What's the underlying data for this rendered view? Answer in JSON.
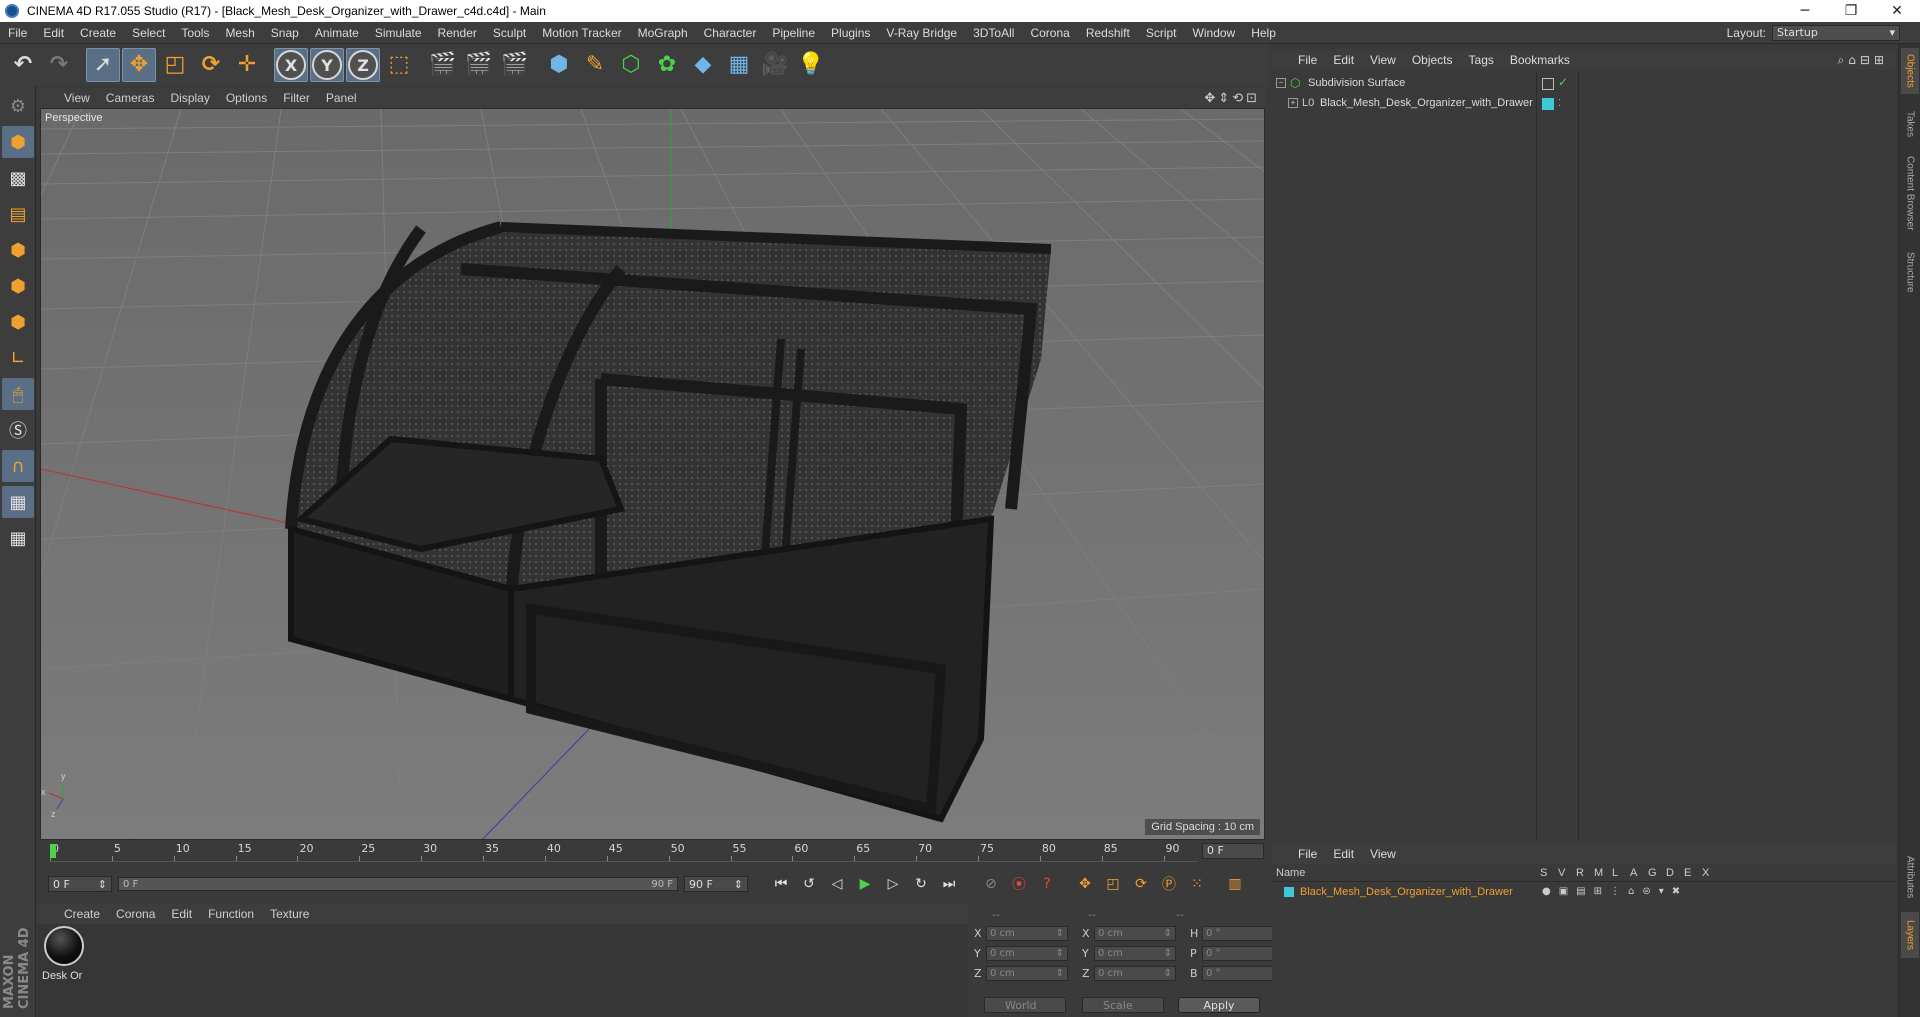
{
  "window": {
    "title": "CINEMA 4D R17.055 Studio (R17) - [Black_Mesh_Desk_Organizer_with_Drawer_c4d.c4d] - Main",
    "minimize": "─",
    "maximize": "❐",
    "close": "✕"
  },
  "menu": {
    "items": [
      "File",
      "Edit",
      "Create",
      "Select",
      "Tools",
      "Mesh",
      "Snap",
      "Animate",
      "Simulate",
      "Render",
      "Sculpt",
      "Motion Tracker",
      "MoGraph",
      "Character",
      "Pipeline",
      "Plugins",
      "V-Ray Bridge",
      "3DToAll",
      "Corona",
      "Redshift",
      "Script",
      "Window",
      "Help"
    ],
    "layout_label": "Layout:",
    "layout_value": "Startup"
  },
  "toolbar": {
    "undo": "↶",
    "redo": "↷",
    "axis_x": "X",
    "axis_y": "Y",
    "axis_z": "Z"
  },
  "viewport": {
    "menu": [
      "View",
      "Cameras",
      "Display",
      "Options",
      "Filter",
      "Panel"
    ],
    "nav_icons": "✥⇕⟲⊡",
    "label": "Perspective",
    "grid_spacing": "Grid Spacing : 10 cm",
    "axis_labels": {
      "x": "x",
      "y": "y",
      "z": "z"
    }
  },
  "timeline": {
    "ticks": [
      "0",
      "5",
      "10",
      "15",
      "20",
      "25",
      "30",
      "35",
      "40",
      "45",
      "50",
      "55",
      "60",
      "65",
      "70",
      "75",
      "80",
      "85",
      "90"
    ],
    "current_frame": "0 F",
    "start_field": "0 F",
    "slider_start": "0 F",
    "slider_end": "90 F",
    "end_field": "90 F"
  },
  "material_manager": {
    "menu": [
      "Create",
      "Corona",
      "Edit",
      "Function",
      "Texture"
    ],
    "material_name": "Desk Or"
  },
  "coordinates": {
    "headers": [
      "--",
      "--",
      "--"
    ],
    "rows": [
      {
        "l1": "X",
        "v1": "0 cm",
        "l2": "X",
        "v2": "0 cm",
        "l3": "H",
        "v3": "0 °"
      },
      {
        "l1": "Y",
        "v1": "0 cm",
        "l2": "Y",
        "v2": "0 cm",
        "l3": "P",
        "v3": "0 °"
      },
      {
        "l1": "Z",
        "v1": "0 cm",
        "l2": "Z",
        "v2": "0 cm",
        "l3": "B",
        "v3": "0 °"
      }
    ],
    "space": "World",
    "mode": "Scale",
    "apply": "Apply"
  },
  "object_manager": {
    "menu": [
      "File",
      "Edit",
      "View",
      "Objects",
      "Tags",
      "Bookmarks"
    ],
    "objects": [
      {
        "name": "Subdivision Surface",
        "expander": "−",
        "color": "#4cd14c"
      },
      {
        "name": "Black_Mesh_Desk_Organizer_with_Drawer",
        "expander": "+",
        "color": "#cccccc"
      }
    ],
    "tag_color": "#3ec9d6"
  },
  "right_tabs": [
    "Objects",
    "Takes",
    "Content Browser",
    "Structure",
    "Attributes",
    "Layers"
  ],
  "layers": {
    "menu": [
      "File",
      "Edit",
      "View"
    ],
    "headers": [
      "Name",
      "S",
      "V",
      "R",
      "M",
      "L",
      "A",
      "G",
      "D",
      "E",
      "X"
    ],
    "row": "Black_Mesh_Desk_Organizer_with_Drawer",
    "row_color": "#3ec9d6"
  },
  "branding": {
    "maxon": "MAXON CINEMA 4D"
  },
  "colors": {
    "accent": "#f0a030",
    "selection": "#5a6f86",
    "play": "#4cd14c"
  }
}
